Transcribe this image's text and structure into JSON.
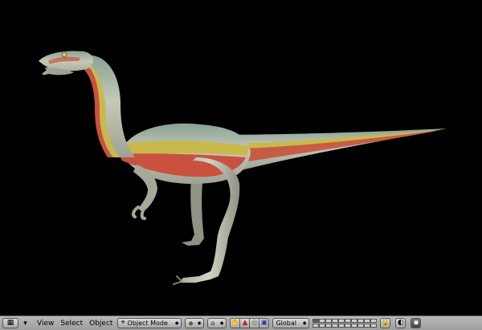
{
  "header": {
    "menus": [
      "View",
      "Select",
      "Object"
    ],
    "mode": "Object Mode",
    "orientation": "Global"
  },
  "icons": {
    "editor_type": "grid-icon",
    "collapse": "triangle-down-icon",
    "mode_icon": "object-mode-icon",
    "draw_type": "draw-type-icon",
    "pivot": "pivot-icon",
    "manipulator": "hand-icon",
    "translate": "translate-icon",
    "rotate": "rotate-icon",
    "scale": "scale-icon",
    "lock": "lock-icon",
    "render": "render-icon",
    "camera": "camera-icon"
  },
  "colors": {
    "header_bg": "#a9a9a9",
    "viewport_bg": "#000000",
    "skin": "#b9bcae",
    "stripe_red": "#c8523e",
    "stripe_yellow": "#c9b94c",
    "back_green": "#7f9a86"
  }
}
